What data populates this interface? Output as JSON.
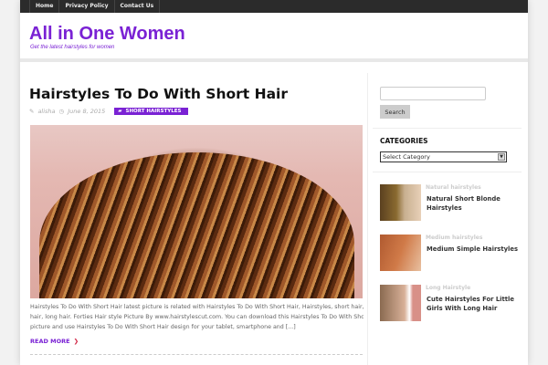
{
  "nav": [
    "Home",
    "Privacy Policy",
    "Contact Us"
  ],
  "site": {
    "title": "All in One Women",
    "tagline": "Get the latest hairstyles for women"
  },
  "post": {
    "title": "Hairstyles To Do With Short Hair",
    "author": "alisha",
    "date": "June 8, 2015",
    "category": "SHORT HAIRSTYLES",
    "excerpt": [
      "Hairstyles To Do With Short Hair latest picture is related with Hairstyles To Do With Short Hair, Hairstyles, short hair,",
      "hair, long hair. Forties Hair style Picture By www.hairstylescut.com. You can download this Hairstyles To Do With Short Hair",
      "picture and use Hairstyles To Do With Short Hair design for your tablet, smartphone and [...]"
    ],
    "read_more": "READ MORE"
  },
  "sidebar": {
    "search_button": "Search",
    "categories_heading": "CATEGORIES",
    "select_value": "Select Category",
    "items": [
      {
        "category": "Natural hairstyles",
        "title": "Natural Short Blonde Hairstyles"
      },
      {
        "category": "Medium hairstyles",
        "title": "Medium Simple Hairstyles"
      },
      {
        "category": "Long Hairstyle",
        "title": "Cute Hairstyles For Little Girls With Long Hair"
      }
    ]
  },
  "colors": {
    "accent": "#7a22d4",
    "nav_bg": "#2b2b2b"
  }
}
